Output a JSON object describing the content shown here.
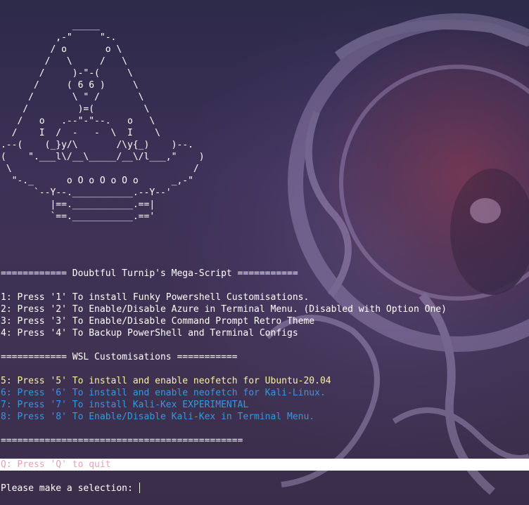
{
  "ascii_art": "             _____\n          ,-\"     \"-.\n         / o       o \\\n        /   \\     /   \\\n       /     )-\"-(     \\\n      /     ( 6 6 )     \\\n     /       \\ \" /       \\\n    /         )=(         \\\n   /   o   .--\"-\"--.   o   \\\n  /    I  /  -   -  \\  I    \\\n.--(    (_}y/\\       /\\y{_)    )--.\n(    \".___l\\/__\\_____/__\\/l___,\"    )\n \\                                 /\n  \"-._      o O o O o O o      _,-\"\n      `--Y--.___________.--Y--'\n         |==.___________.==|\n         `==.___________.=='",
  "menu": {
    "header": "============ Doubtful Turnip's Mega-Script ===========",
    "items": [
      "1: Press '1' To install Funky Powershell Customisations.",
      "2: Press '2' To Enable/Disable Azure in Terminal Menu. (Disabled with Option One)",
      "3: Press '3' To Enable/Disable Command Prompt Retro Theme",
      "4: Press '4' To Backup PowerShell and Terminal Configs"
    ],
    "wsl_header": "============ WSL Customisations ===========",
    "wsl_items": [
      "5: Press '5' To install and enable neofetch for Ubuntu-20.04",
      "6: Press '6' To install and enable neofetch for Kali-Linux.",
      "7: Press '7' To install Kali-Kex EXPERIMENTAL",
      "8: Press '8' To Enable/Disable Kali-Kex in Terminal Menu."
    ],
    "divider": "============================================",
    "quit": "Q: Press 'Q' to quit",
    "prompt": "Please make a selection: "
  },
  "colors": {
    "text": "#ffffff",
    "yellow": "#f9f1a5",
    "blue": "#3a96dd",
    "quit_text": "#e6a3b8",
    "quit_bg": "#ffffff",
    "background": "#3b2f52"
  }
}
